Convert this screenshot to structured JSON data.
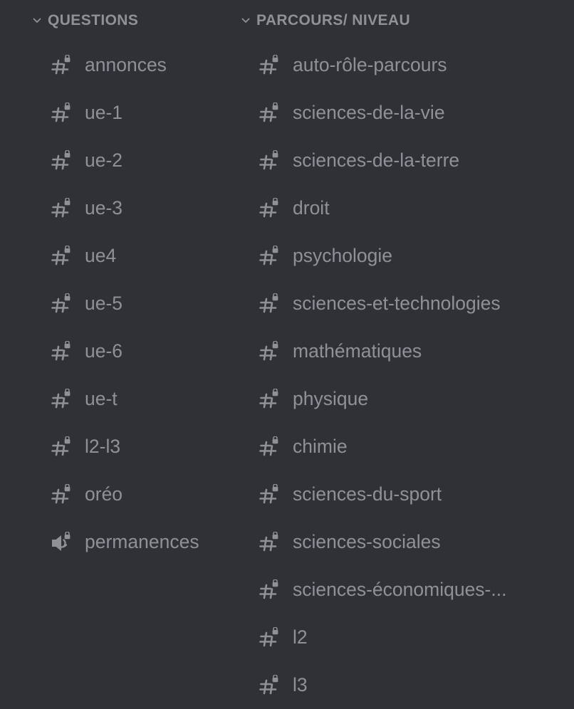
{
  "colors": {
    "background": "#2f3136",
    "text_muted": "#8e9297"
  },
  "categories": [
    {
      "label": "QUESTIONS",
      "channels": [
        {
          "name": "annonces",
          "icon": "hashtag-lock-icon"
        },
        {
          "name": "ue-1",
          "icon": "hashtag-lock-icon"
        },
        {
          "name": "ue-2",
          "icon": "hashtag-lock-icon"
        },
        {
          "name": "ue-3",
          "icon": "hashtag-lock-icon"
        },
        {
          "name": "ue4",
          "icon": "hashtag-lock-icon"
        },
        {
          "name": "ue-5",
          "icon": "hashtag-lock-icon"
        },
        {
          "name": "ue-6",
          "icon": "hashtag-lock-icon"
        },
        {
          "name": "ue-t",
          "icon": "hashtag-lock-icon"
        },
        {
          "name": "l2-l3",
          "icon": "hashtag-lock-icon"
        },
        {
          "name": "oréo",
          "icon": "hashtag-lock-icon"
        },
        {
          "name": "permanences",
          "icon": "speaker-lock-icon"
        }
      ]
    },
    {
      "label": "PARCOURS/ NIVEAU",
      "channels": [
        {
          "name": "auto-rôle-parcours",
          "icon": "hashtag-lock-icon"
        },
        {
          "name": "sciences-de-la-vie",
          "icon": "hashtag-lock-icon"
        },
        {
          "name": "sciences-de-la-terre",
          "icon": "hashtag-lock-icon"
        },
        {
          "name": "droit",
          "icon": "hashtag-lock-icon"
        },
        {
          "name": "psychologie",
          "icon": "hashtag-lock-icon"
        },
        {
          "name": "sciences-et-technologies",
          "icon": "hashtag-lock-icon"
        },
        {
          "name": "mathématiques",
          "icon": "hashtag-lock-icon"
        },
        {
          "name": "physique",
          "icon": "hashtag-lock-icon"
        },
        {
          "name": "chimie",
          "icon": "hashtag-lock-icon"
        },
        {
          "name": "sciences-du-sport",
          "icon": "hashtag-lock-icon"
        },
        {
          "name": "sciences-sociales",
          "icon": "hashtag-lock-icon"
        },
        {
          "name": "sciences-économiques-...",
          "icon": "hashtag-lock-icon"
        },
        {
          "name": "l2",
          "icon": "hashtag-lock-icon"
        },
        {
          "name": "l3",
          "icon": "hashtag-lock-icon"
        }
      ]
    }
  ]
}
